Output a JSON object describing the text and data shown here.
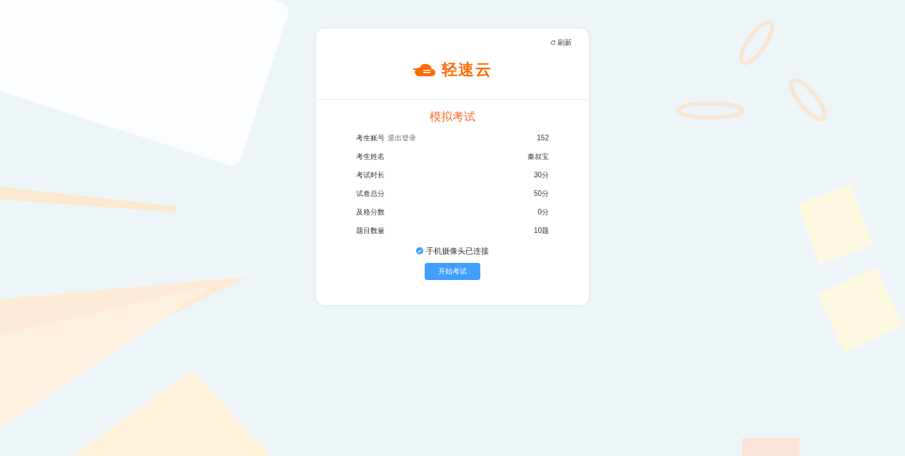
{
  "refresh": {
    "label": "刷新"
  },
  "logo": {
    "text": "轻速云"
  },
  "title": "模拟考试",
  "info_rows": [
    {
      "label": "考生账号",
      "link": "退出登录",
      "value": "152"
    },
    {
      "label": "考生姓名",
      "value": "秦叔宝"
    },
    {
      "label": "考试时长",
      "value": "30分"
    },
    {
      "label": "试卷总分",
      "value": "50分"
    },
    {
      "label": "及格分数",
      "value": "0分"
    },
    {
      "label": "题目数量",
      "value": "10题"
    }
  ],
  "camera": {
    "label": "手机摄像头已连接",
    "connected": true
  },
  "start_button": "开始考试"
}
